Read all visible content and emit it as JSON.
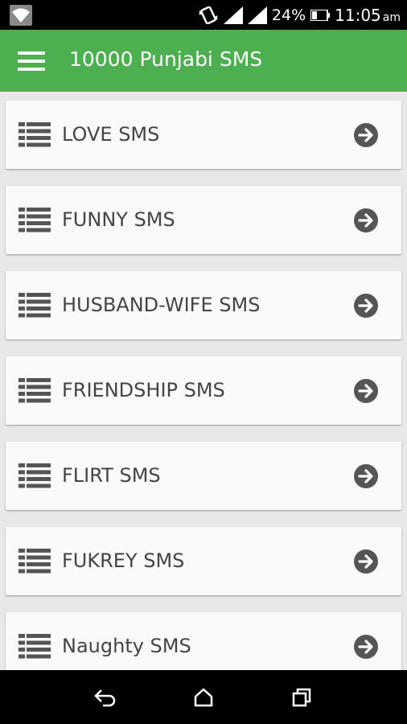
{
  "colors": {
    "app_bar": "#4caf50",
    "status_bar": "#000000",
    "card_text": "#444444",
    "icon": "#555555"
  },
  "status_bar": {
    "icons": [
      "wifi-icon",
      "vibrate-icon",
      "signal-icon",
      "signal-icon",
      "battery-icon"
    ],
    "battery": "24%",
    "time": "11:05",
    "ampm": "am"
  },
  "app_bar": {
    "menu_icon": "hamburger-menu-icon",
    "title": "10000 Punjabi SMS"
  },
  "categories": [
    {
      "label": "LOVE SMS",
      "icon": "list-icon",
      "action_icon": "arrow-right-circle-icon"
    },
    {
      "label": "FUNNY SMS",
      "icon": "list-icon",
      "action_icon": "arrow-right-circle-icon"
    },
    {
      "label": "HUSBAND-WIFE SMS",
      "icon": "list-icon",
      "action_icon": "arrow-right-circle-icon"
    },
    {
      "label": "FRIENDSHIP SMS",
      "icon": "list-icon",
      "action_icon": "arrow-right-circle-icon"
    },
    {
      "label": "FLIRT SMS",
      "icon": "list-icon",
      "action_icon": "arrow-right-circle-icon"
    },
    {
      "label": "FUKREY SMS",
      "icon": "list-icon",
      "action_icon": "arrow-right-circle-icon"
    },
    {
      "label": "Naughty SMS",
      "icon": "list-icon",
      "action_icon": "arrow-right-circle-icon"
    }
  ],
  "nav_bar": {
    "icons": [
      "back-icon",
      "home-icon",
      "recents-icon"
    ]
  }
}
